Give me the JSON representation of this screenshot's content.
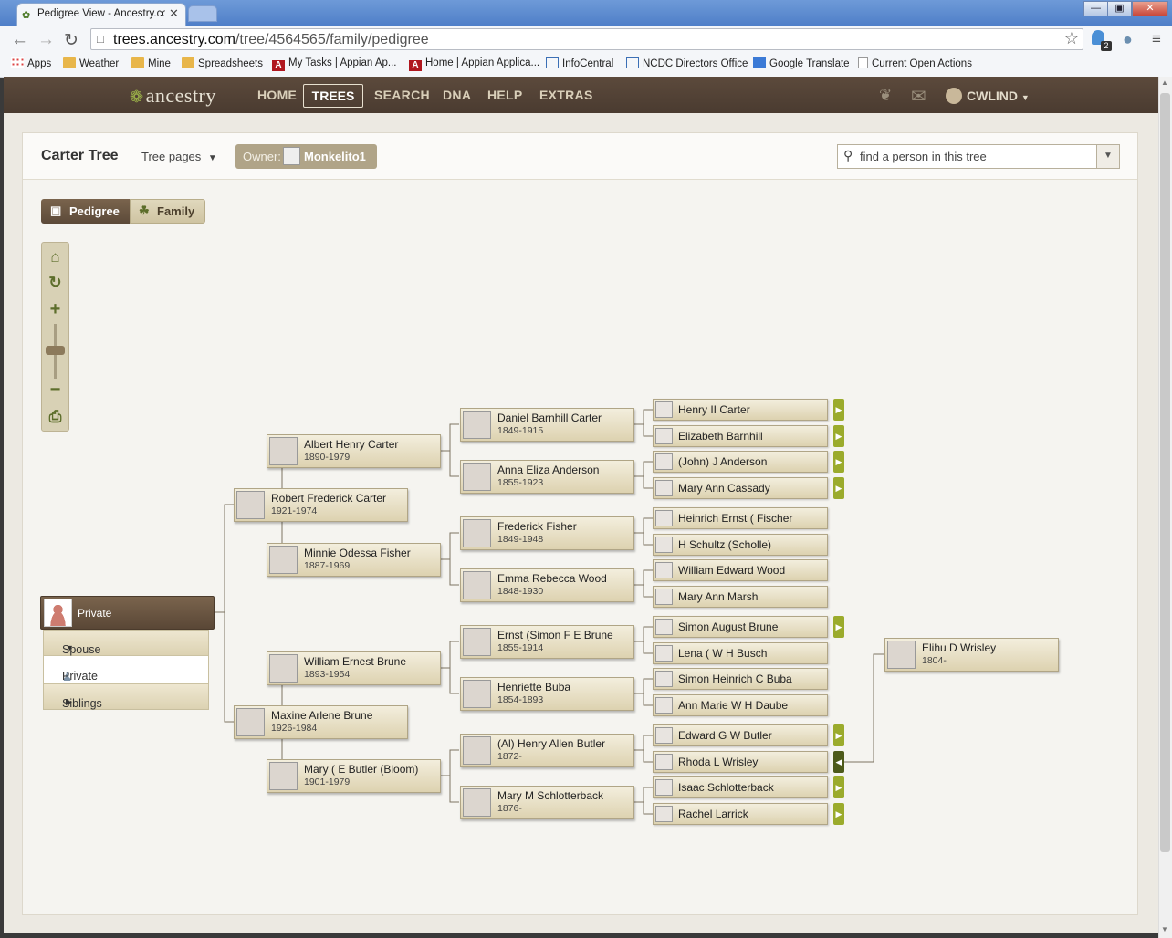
{
  "browser": {
    "tab_title": "Pedigree View - Ancestry.co",
    "tab_close": "✕",
    "url_domain": "trees.ancestry.com",
    "url_path": "/tree/4564565/family/pedigree",
    "extension_badge": "2",
    "bookmarks": [
      "Apps",
      "Weather",
      "Mine",
      "Spreadsheets",
      "My Tasks | Appian Ap...",
      "Home | Appian Applica...",
      "InfoCentral",
      "NCDC Directors Office",
      "Google Translate",
      "Current Open Actions"
    ]
  },
  "site": {
    "logo": "ancestry",
    "nav": [
      "HOME",
      "TREES",
      "SEARCH",
      "DNA",
      "HELP",
      "EXTRAS"
    ],
    "user": "CWLIND"
  },
  "tree": {
    "title": "Carter Tree",
    "tree_pages": "Tree pages",
    "owner_label": "Owner:",
    "owner_name": "Monkelito1",
    "search_placeholder": "find a person in this tree",
    "view_pedigree": "Pedigree",
    "view_family": "Family"
  },
  "root": {
    "name": "Private",
    "menu_spouse": "Spouse & Children",
    "menu_private": "Private",
    "menu_siblings": "Siblings"
  },
  "people": {
    "robert": {
      "name": "Robert Frederick Carter",
      "dates": "1921-1974"
    },
    "maxine": {
      "name": "Maxine Arlene Brune",
      "dates": "1926-1984"
    },
    "albert": {
      "name": "Albert Henry Carter",
      "dates": "1890-1979"
    },
    "minnie": {
      "name": "Minnie Odessa Fisher",
      "dates": "1887-1969"
    },
    "william": {
      "name": "William Ernest Brune",
      "dates": "1893-1954"
    },
    "maryb": {
      "name": "Mary ( E Butler (Bloom)",
      "dates": "1901-1979"
    },
    "daniel": {
      "name": "Daniel Barnhill Carter",
      "dates": "1849-1915"
    },
    "anna": {
      "name": "Anna Eliza Anderson",
      "dates": "1855-1923"
    },
    "frederick": {
      "name": "Frederick Fisher",
      "dates": "1849-1948"
    },
    "emma": {
      "name": "Emma Rebecca Wood",
      "dates": "1848-1930"
    },
    "ernst": {
      "name": "Ernst (Simon F E Brune",
      "dates": "1855-1914"
    },
    "henriette": {
      "name": "Henriette Buba",
      "dates": "1854-1893"
    },
    "al": {
      "name": "(Al) Henry Allen Butler",
      "dates": "1872-"
    },
    "marym": {
      "name": "Mary M Schlotterback",
      "dates": "1876-"
    },
    "elihu": {
      "name": "Elihu D Wrisley",
      "dates": "1804-"
    }
  },
  "gen4": [
    "Henry II Carter",
    "Elizabeth Barnhill",
    "(John) J Anderson",
    "Mary Ann Cassady",
    "Heinrich Ernst ( Fischer",
    "H Schultz (Scholle)",
    "William Edward Wood",
    "Mary Ann Marsh",
    "Simon August Brune",
    "Lena ( W H Busch",
    "Simon Heinrich C Buba",
    "Ann Marie W H Daube",
    "Edward G W Butler",
    "Rhoda L Wrisley",
    "Isaac Schlotterback",
    "Rachel Larrick"
  ]
}
